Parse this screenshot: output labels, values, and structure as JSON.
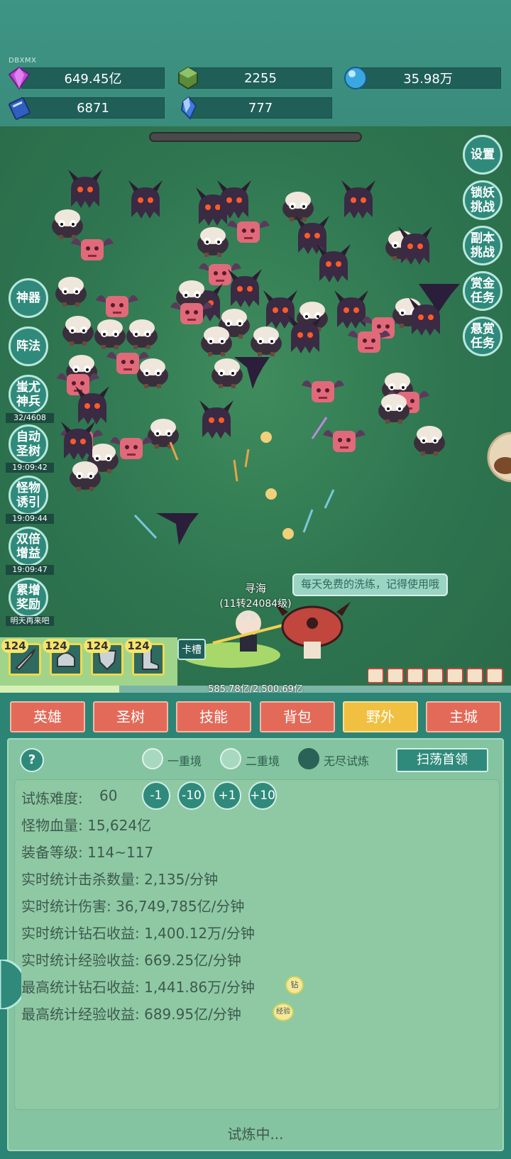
{
  "header": {
    "watermark": "DBXMX",
    "resources": [
      {
        "icon": "purple-gem-icon",
        "value": "649.45亿"
      },
      {
        "icon": "green-crystal-icon",
        "value": "2255"
      },
      {
        "icon": "blue-orb-icon",
        "value": "35.98万"
      },
      {
        "icon": "blue-book-icon",
        "value": "6871"
      },
      {
        "icon": "blue-shard-icon",
        "value": "777"
      }
    ]
  },
  "right_buttons": [
    {
      "label": "设置"
    },
    {
      "label": "锁妖\n挑战"
    },
    {
      "label": "副本\n挑战"
    },
    {
      "label": "赏金\n任务"
    },
    {
      "label": "悬赏\n任务"
    }
  ],
  "left_buttons": [
    {
      "label": "神器",
      "sub": ""
    },
    {
      "label": "阵法",
      "sub": ""
    },
    {
      "label": "蚩尤\n神兵",
      "sub": "32/4608"
    },
    {
      "label": "自动\n圣树",
      "sub": "19:09:42"
    },
    {
      "label": "怪物\n诱引",
      "sub": "19:09:44"
    },
    {
      "label": "双倍\n增益",
      "sub": "19:09:47"
    },
    {
      "label": "累增\n奖励",
      "sub": "明天再来吧"
    }
  ],
  "player": {
    "name": "寻海",
    "level": "(11转24084级)",
    "tip": "每天免费的洗练，记得使用哦"
  },
  "equipment": [
    {
      "level": "124",
      "icon": "sword-icon"
    },
    {
      "level": "124",
      "icon": "helmet-icon"
    },
    {
      "level": "124",
      "icon": "shield-icon"
    },
    {
      "level": "124",
      "icon": "boots-icon"
    }
  ],
  "card_slot": "卡槽",
  "exp": {
    "text": "585.78亿/2,500.69亿",
    "progress": 0.234
  },
  "tabs": [
    {
      "label": "英雄",
      "active": false
    },
    {
      "label": "圣树",
      "active": false
    },
    {
      "label": "技能",
      "active": false
    },
    {
      "label": "背包",
      "active": false
    },
    {
      "label": "野外",
      "active": true
    },
    {
      "label": "主城",
      "active": false
    }
  ],
  "panel": {
    "help": "?",
    "modes": [
      {
        "label": "一重境",
        "selected": false
      },
      {
        "label": "二重境",
        "selected": false
      },
      {
        "label": "无尽试炼",
        "selected": true
      }
    ],
    "sweep_button": "扫荡首领",
    "difficulty_label": "试炼难度:",
    "difficulty_value": "60",
    "adjust": [
      "-1",
      "-10",
      "+1",
      "+10"
    ],
    "stats": [
      "怪物血量: 15,624亿",
      "装备等级: 114~117",
      "实时统计击杀数量: 2,135/分钟",
      "实时统计伤害: 36,749,785亿/分钟",
      "实时统计钻石收益: 1,400.12万/分钟",
      "实时统计经验收益: 669.25亿/分钟",
      "最高统计钻石收益: 1,441.86万/分钟",
      "最高统计经验收益: 689.95亿/分钟"
    ],
    "badge_diamond": "钻",
    "badge_exp": "经验",
    "status": "试炼中..."
  }
}
